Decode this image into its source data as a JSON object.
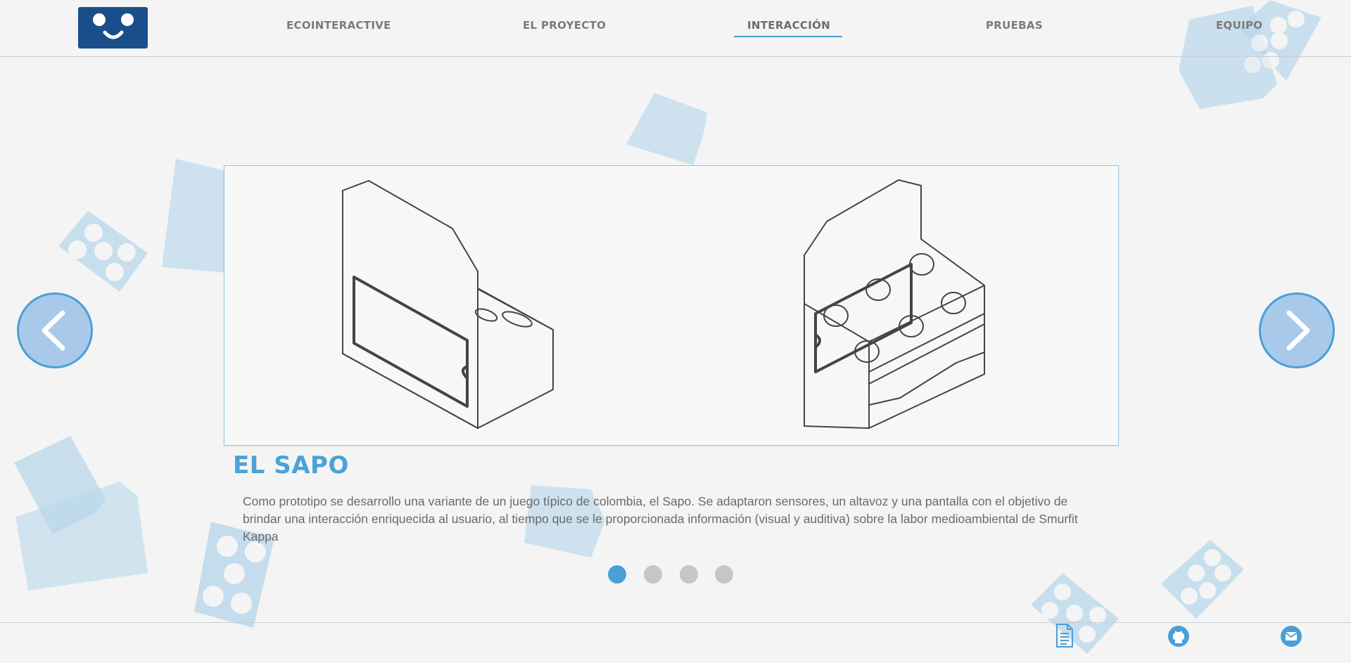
{
  "header": {
    "logo": {
      "icon": "smiley-face-icon",
      "color": "#1a4e8a"
    },
    "nav": [
      {
        "label": "ECOINTERACTIVE",
        "active": false
      },
      {
        "label": "EL PROYECTO",
        "active": false
      },
      {
        "label": "INTERACCIÓN",
        "active": true
      },
      {
        "label": "PRUEBAS",
        "active": false
      },
      {
        "label": "EQUIPO",
        "active": false
      }
    ]
  },
  "carousel": {
    "prev_icon": "chevron-left-icon",
    "next_icon": "chevron-right-icon",
    "slide_image": "sapo-prototype-line-drawings",
    "title": "EL SAPO",
    "description": "Como prototipo se desarrollo una variante de un juego típico de colombia, el Sapo. Se adaptaron sensores, un altavoz y una pantalla con el objetivo de brindar una interacción enriquecida al usuario, al tiempo que se le proporcionada información (visual y auditiva) sobre la labor medioambiental de Smurfit Kappa",
    "slide_count": 4,
    "active_slide": 1
  },
  "footer": {
    "icons": [
      "document-icon",
      "github-icon",
      "mail-icon"
    ]
  },
  "colors": {
    "accent": "#4a9fd6",
    "title": "#4aa2d8",
    "background": "#f4f4f4",
    "decoration": "#b9d7eb"
  }
}
